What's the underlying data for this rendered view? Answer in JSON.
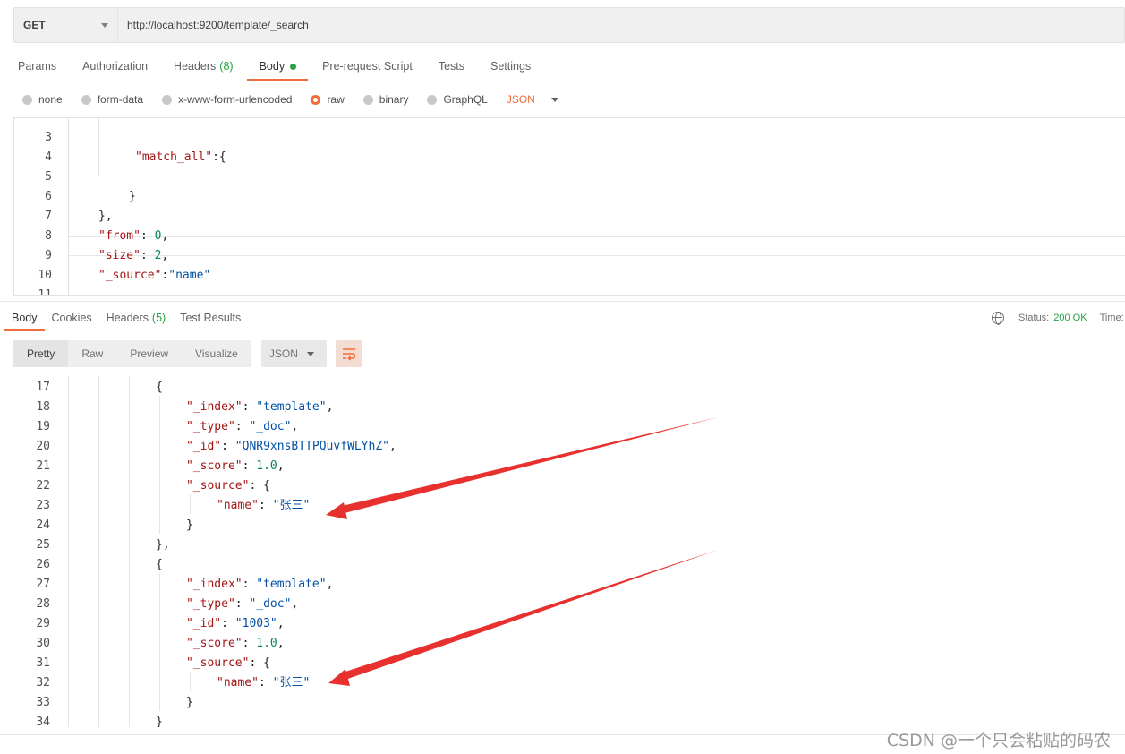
{
  "request": {
    "method": "GET",
    "url": "http://localhost:9200/template/_search"
  },
  "request_tabs": [
    {
      "label": "Params"
    },
    {
      "label": "Authorization"
    },
    {
      "label": "Headers",
      "count": "(8)"
    },
    {
      "label": "Body",
      "active": true,
      "indicator": "green-dot"
    },
    {
      "label": "Pre-request Script"
    },
    {
      "label": "Tests"
    },
    {
      "label": "Settings"
    }
  ],
  "body_types": {
    "options": [
      "none",
      "form-data",
      "x-www-form-urlencoded",
      "raw",
      "binary",
      "GraphQL"
    ],
    "selected": "raw",
    "format": "JSON"
  },
  "request_editor": {
    "lines": [
      {
        "num": "3",
        "text": "\"match_all\":{"
      },
      {
        "num": "4",
        "text": ""
      },
      {
        "num": "5",
        "text": "}"
      },
      {
        "num": "6",
        "text": "},"
      },
      {
        "num": "7",
        "text": "\"from\": 0,"
      },
      {
        "num": "8",
        "text": "\"size\": 2,"
      },
      {
        "num": "9",
        "text": "\"_source\":\"name\""
      },
      {
        "num": "10",
        "text": ""
      },
      {
        "num": "11",
        "text": "}"
      }
    ]
  },
  "response_tabs": [
    {
      "label": "Body",
      "active": true
    },
    {
      "label": "Cookies"
    },
    {
      "label": "Headers",
      "count": "(5)"
    },
    {
      "label": "Test Results"
    }
  ],
  "response_status": {
    "status_label": "Status:",
    "status_value": "200 OK",
    "time_label": "Time:"
  },
  "response_toolbar": {
    "view_modes": [
      "Pretty",
      "Raw",
      "Preview",
      "Visualize"
    ],
    "active_view": "Pretty",
    "format": "JSON",
    "wrap_icon": "wrap-lines-icon"
  },
  "response_editor": {
    "lines": [
      {
        "num": "17",
        "text": "{"
      },
      {
        "num": "18",
        "text": "\"_index\": \"template\","
      },
      {
        "num": "19",
        "text": "\"_type\": \"_doc\","
      },
      {
        "num": "20",
        "text": "\"_id\": \"QNR9xnsBTTPQuvfWLYhZ\","
      },
      {
        "num": "21",
        "text": "\"_score\": 1.0,"
      },
      {
        "num": "22",
        "text": "\"_source\": {"
      },
      {
        "num": "23",
        "text": "\"name\": \"张三\""
      },
      {
        "num": "24",
        "text": "}"
      },
      {
        "num": "25",
        "text": "},"
      },
      {
        "num": "26",
        "text": "{"
      },
      {
        "num": "27",
        "text": "\"_index\": \"template\","
      },
      {
        "num": "28",
        "text": "\"_type\": \"_doc\","
      },
      {
        "num": "29",
        "text": "\"_id\": \"1003\","
      },
      {
        "num": "30",
        "text": "\"_score\": 1.0,"
      },
      {
        "num": "31",
        "text": "\"_source\": {"
      },
      {
        "num": "32",
        "text": "\"name\": \"张三\""
      },
      {
        "num": "33",
        "text": "}"
      },
      {
        "num": "34",
        "text": "}"
      }
    ]
  },
  "annotations": {
    "arrow_color": "#e8312f"
  },
  "watermark": "CSDN @一个只会粘贴的码农",
  "colors": {
    "accent": "#f26b3a",
    "success": "#26a33e",
    "json_key": "#a31515",
    "json_string": "#0451a5",
    "json_number": "#098658"
  }
}
